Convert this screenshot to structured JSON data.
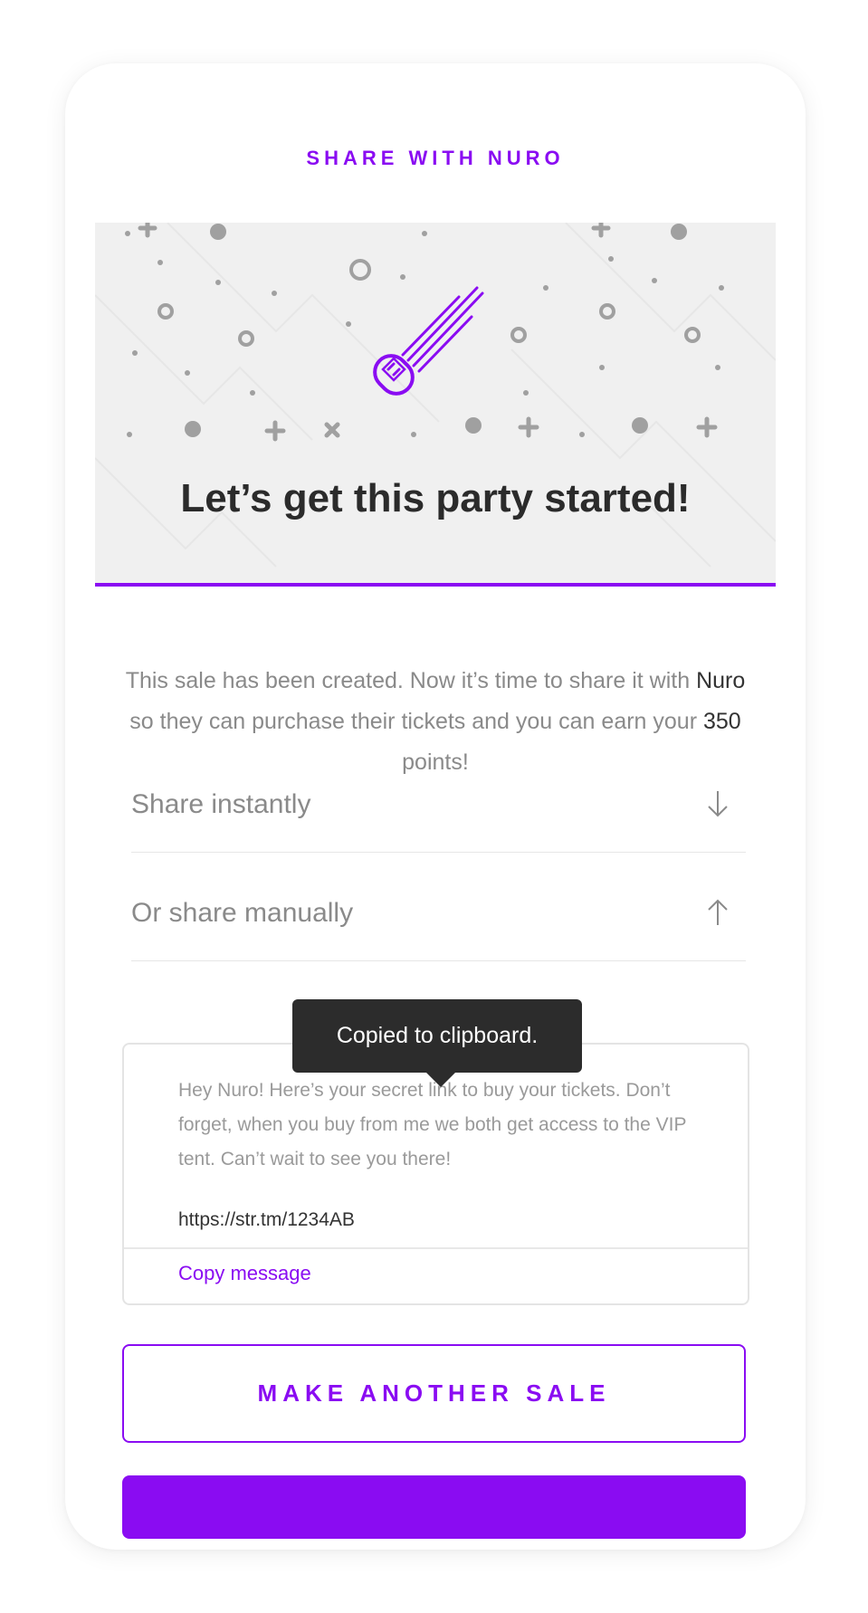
{
  "header": {
    "eyebrow": "SHARE WITH NURO"
  },
  "hero": {
    "title": "Let’s get this party started!"
  },
  "intro": {
    "part1": "This sale has been created. Now it’s time to share it with ",
    "name": "Nuro",
    "part2": " so they can purchase their tickets and you can earn your ",
    "points": "350",
    "part3": " points!"
  },
  "accordion": [
    {
      "label": "Share instantly",
      "icon": "arrow-down-icon",
      "expanded": false
    },
    {
      "label": "Or share manually",
      "icon": "arrow-up-icon",
      "expanded": true
    }
  ],
  "message": {
    "text": "Hey Nuro! Here’s your secret link to buy your tickets. Don’t forget, when you buy from me we both get access to the VIP tent. Can’t wait to see you there!",
    "link": "https://str.tm/1234AB",
    "copy_label": "Copy message"
  },
  "tooltip": {
    "text": "Copied to clipboard."
  },
  "buttons": {
    "make_another_sale": "MAKE ANOTHER SALE"
  },
  "colors": {
    "accent": "#8a0cf2",
    "text_dark": "#2b2b2b",
    "text_muted": "#8a8a8a",
    "hero_bg": "#f0f0f0",
    "tooltip_bg": "#2c2c2c"
  }
}
